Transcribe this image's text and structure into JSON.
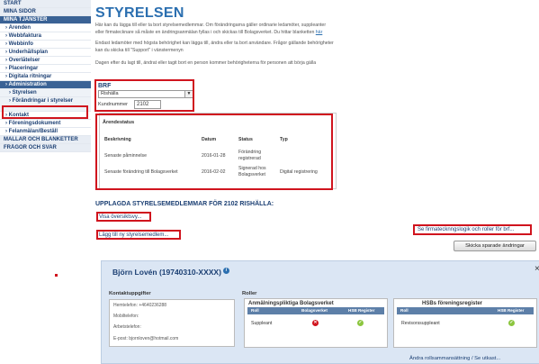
{
  "sidebar": {
    "items": [
      {
        "label": "START",
        "kind": "top"
      },
      {
        "label": "MINA SIDOR",
        "kind": "top"
      },
      {
        "label": "MINA TJÄNSTER",
        "kind": "head"
      },
      {
        "label": "Ärenden",
        "kind": "sub"
      },
      {
        "label": "Webbfaktura",
        "kind": "sub"
      },
      {
        "label": "Webbinfo",
        "kind": "sub"
      },
      {
        "label": "Underhållsplan",
        "kind": "sub"
      },
      {
        "label": "Overlåtelser",
        "kind": "sub"
      },
      {
        "label": "Placeringar",
        "kind": "sub"
      },
      {
        "label": "Digitala ritningar",
        "kind": "sub"
      },
      {
        "label": "Administration",
        "kind": "active"
      },
      {
        "label": "Styrelsen",
        "kind": "sub2"
      },
      {
        "label": "Förändringar i styrelser",
        "kind": "sub2tall"
      },
      {
        "label": "Kontakt",
        "kind": "sub"
      },
      {
        "label": "Föreningsdokument",
        "kind": "sub"
      },
      {
        "label": "Felanmälan/Beställ",
        "kind": "sub"
      },
      {
        "label": "MALLAR OCH BLANKETTER",
        "kind": "foot"
      },
      {
        "label": "FRÅGOR OCH SVAR",
        "kind": "foot"
      }
    ]
  },
  "main": {
    "title": "STYRELSEN",
    "para1_a": "Här kan du lägga till eller ta bort styrelsemedlemmar. Om förändringarna gäller ordinarie ledamöter, suppleanter",
    "para1_b": "eller firmatecknare så måste en ändringsanmälan fyllas i och skickas till Bolagsverket. Du hittar blanketten ",
    "para1_link": "här",
    "para2_a": "Endast ledamöter med högsta behörighet kan lägga till, ändra eller ta bort användare. Frågor gällande behörigheter",
    "para2_b": "kan du skicka till \"Support\" i vänstermenyn",
    "para3": "Dagen efter du lagt till, ändrat eller tagit bort en person kommer behörigheterna för personen att börja gälla"
  },
  "brf": {
    "label": "BRF",
    "selected": "Rishälla",
    "kundnummer_label": "Kundnummer",
    "kundnummer_value": "2102"
  },
  "arendestatus": {
    "title": "Ärendestatus",
    "headers": [
      "Beskrivning",
      "Datum",
      "Status",
      "Typ"
    ],
    "rows": [
      {
        "beskrivning": "Senaste påminnelse",
        "datum": "2016-01-28",
        "status": "Förändring registrerad",
        "typ": ""
      },
      {
        "beskrivning": "Senaste förändring till Bolagsverket",
        "datum": "2016-02-02",
        "status": "Signerad hos Bolagsverket",
        "typ": "Digital registrering"
      }
    ]
  },
  "members": {
    "heading": "UPPLAGDA STYRELSEMEDLEMMAR FÖR 2102 RISHÄLLA:",
    "overview_link": "Visa översiktsvy...",
    "add_link": "Lägg till ny styrelsemedlem...",
    "firma_link": "Se firmatecknngslogik och roller för brf...",
    "save_button": "Skicka sparade ändringar"
  },
  "person": {
    "name": "Björn Lovén (19740310-XXXX)",
    "info_icon": "i",
    "close": "×",
    "contact_title": "Kontaktuppgifter",
    "contact": [
      "Hemtelefon: +4640236288",
      "Mobiltelefon:",
      "Arbetstelefon:",
      "E-post: bjornloven@hotmail.com"
    ],
    "roles_title": "Roller",
    "bolagsverket": {
      "title": "Anmälningspliktiga Bolagsverket",
      "headers": [
        "Roll",
        "Bolagsverket",
        "HSB Register"
      ],
      "role": "Suppleant",
      "bolagsverket_status": "no",
      "hsb_status": "ok"
    },
    "hsb": {
      "title": "HSBs föreningsregister",
      "headers": [
        "Roll",
        "HSB Register"
      ],
      "role": "Revisorssuppleant",
      "hsb_status": "ok"
    },
    "footer_link": "Ändra rollsammansättning / Se utkast..."
  },
  "colors": {
    "accent": "#2b6fb0",
    "nav_dark": "#1b3f73",
    "highlight": "#d0141e",
    "card_bg": "#dbe6f4"
  }
}
